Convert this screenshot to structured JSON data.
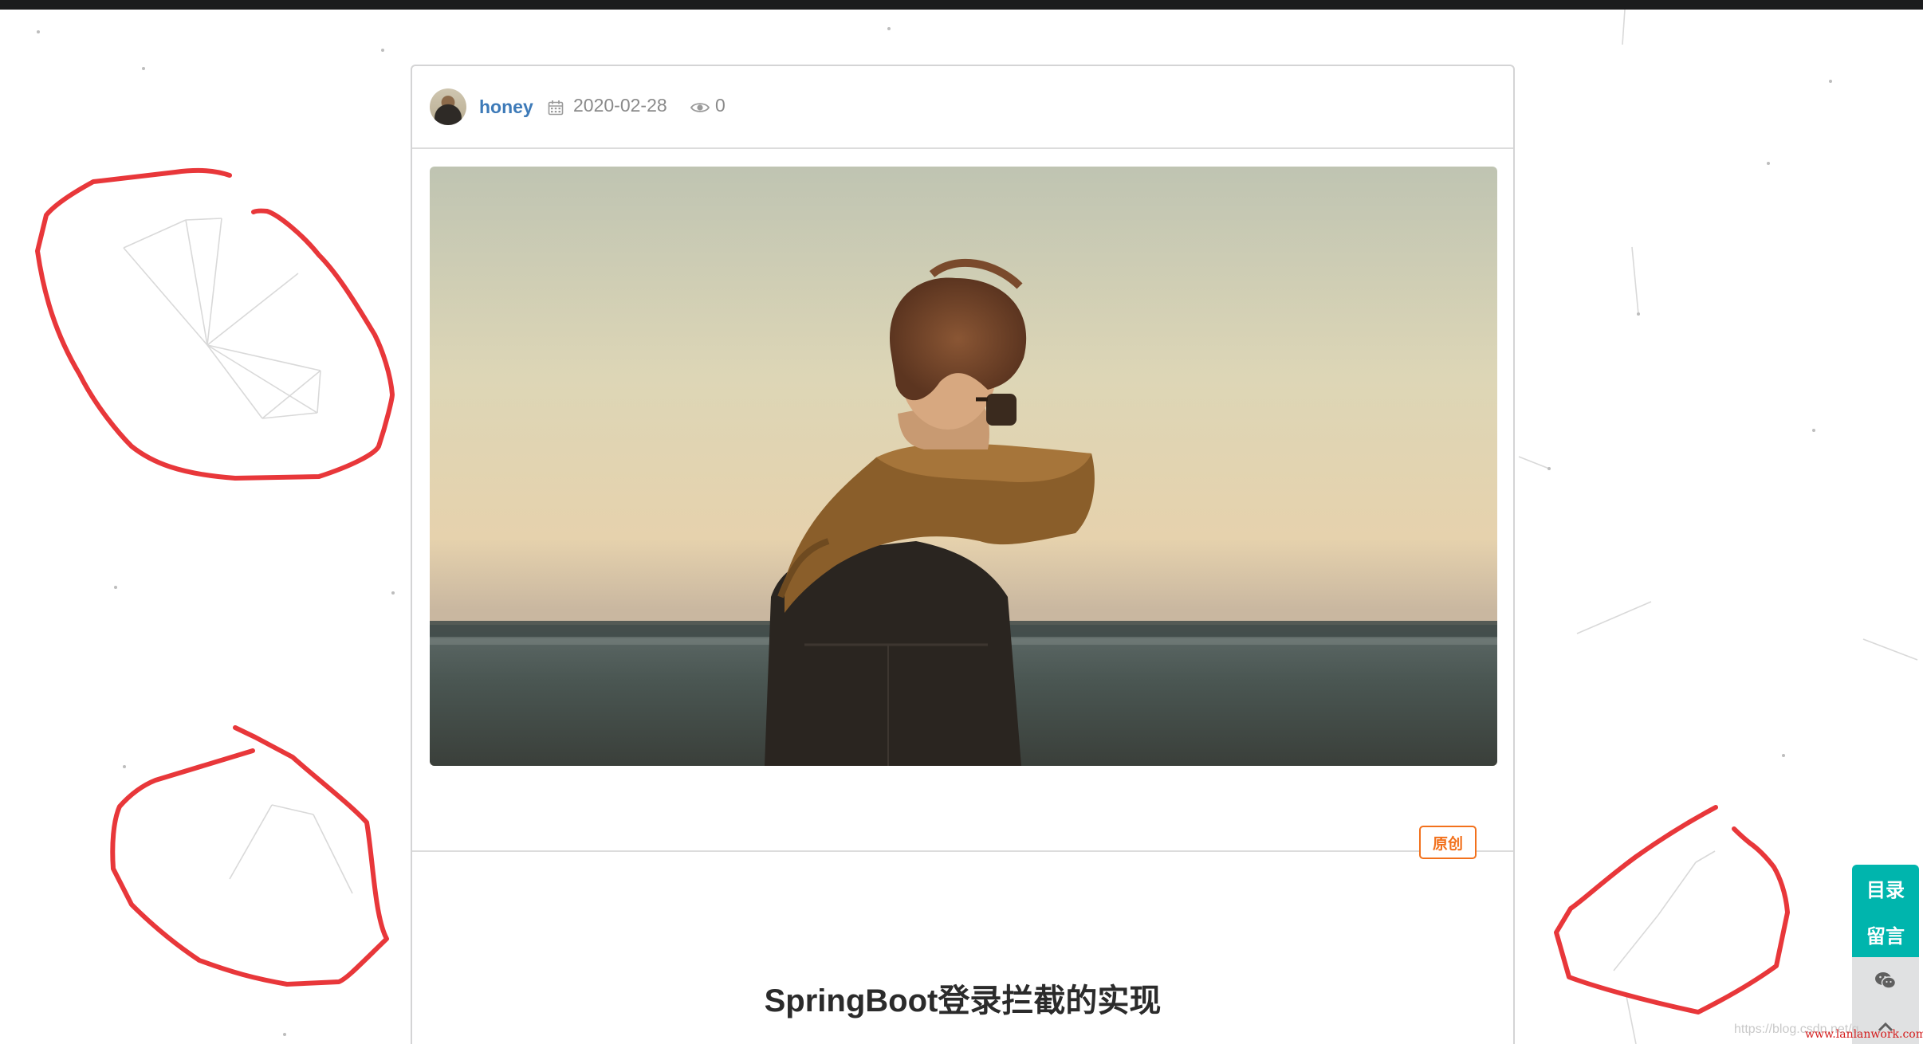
{
  "post": {
    "author": "honey",
    "date": "2020-02-28",
    "views": "0",
    "badge": "原创",
    "title": "SpringBoot登录拦截的实现"
  },
  "side_tools": {
    "toc_label": "目录",
    "comment_label": "留言"
  },
  "icons": {
    "calendar": "calendar-icon",
    "views": "eye-icon",
    "wechat": "wechat-icon",
    "to_top": "chevron-up-icon"
  },
  "watermark": {
    "faint": "https://blog.csdn.net/q...",
    "red": "www.lanlanwork.com"
  },
  "colors": {
    "top_bar": "#1b1c1d",
    "author": "#3d7ab8",
    "badge": "#f2711c",
    "tool_teal": "#00b5ad",
    "annotation": "#e8373a"
  }
}
